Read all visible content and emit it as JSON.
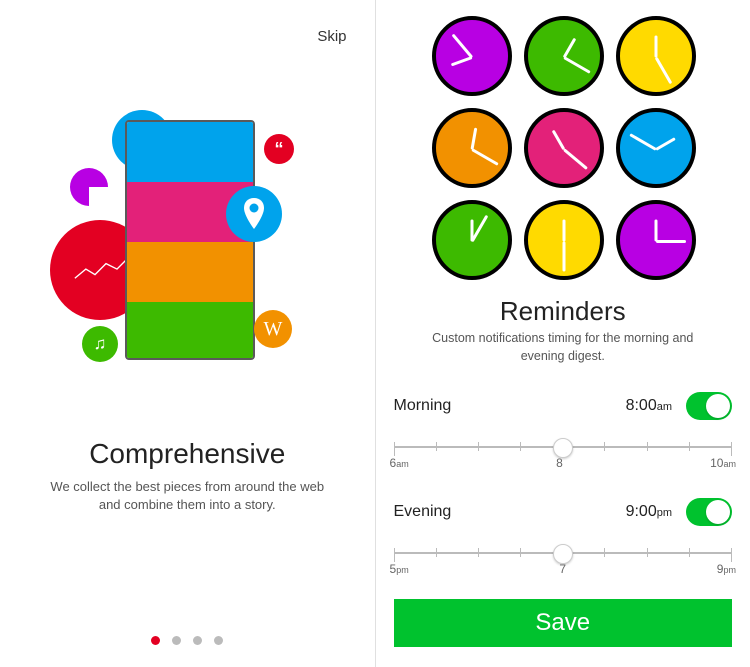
{
  "left": {
    "skip_label": "Skip",
    "title": "Comprehensive",
    "description": "We collect the best pieces from around the web and combine them into a story.",
    "active_dot": 0,
    "dot_count": 4,
    "wiki_letter": "W",
    "music_glyph": "♫",
    "quote_glyph": "“"
  },
  "right": {
    "title": "Reminders",
    "description": "Custom notifications timing for the morning and evening digest.",
    "morning": {
      "label": "Morning",
      "time": "8:00",
      "period": "am",
      "toggle": true,
      "slider": {
        "min_label": "6",
        "min_period": "am",
        "mid_label": "8",
        "max_label": "10",
        "max_period": "am",
        "position_pct": 50
      }
    },
    "evening": {
      "label": "Evening",
      "time": "9:00",
      "period": "pm",
      "toggle": true,
      "slider": {
        "min_label": "5",
        "min_period": "pm",
        "mid_label": "7",
        "max_label": "9",
        "max_period": "pm",
        "position_pct": 50
      }
    },
    "save_label": "Save"
  }
}
